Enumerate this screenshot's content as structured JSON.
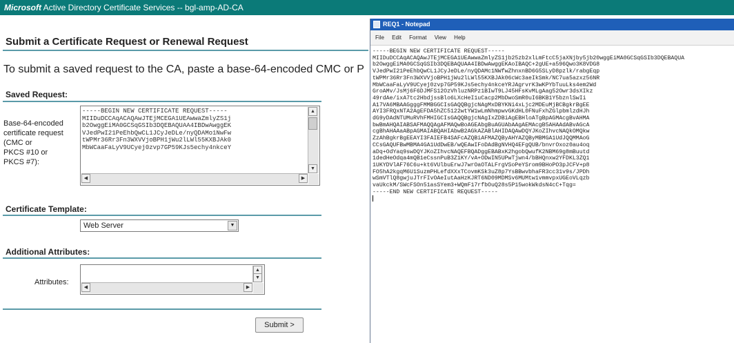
{
  "window": {
    "brand": "Microsoft",
    "title": "Active Directory Certificate Services  --  bgl-amp-AD-CA"
  },
  "page": {
    "heading": "Submit a Certificate Request or Renewal Request",
    "intro": "To submit a saved request to the CA, paste a base-64-encoded CMC or P"
  },
  "saved_request": {
    "section_title": "Saved Request:",
    "label": "Base-64-encoded\ncertificate request\n(CMC or\nPKCS #10 or\nPKCS #7):",
    "lines": [
      "-----BEGIN NEW CERTIFICATE REQUEST-----",
      "MIIDuDCCAqACAQAwJTEjMCEGA1UEAwwaZmlyZS1j",
      "b2OwggEiMA0GCSqGSIb3DQEBAQUAA4IBDwAwggEK",
      "VJedPwI21PeEhbQwCL1JCyJeDLe/nyQDAMo1NwFw",
      "tWPMr36Rr3Fn3WXVVjoBPH1jWu2lLWl55KXBJAk0",
      "MbWCaaFaLyV9UCyej0zvp7GP59KJs5echy4nkceY"
    ]
  },
  "template": {
    "section_title": "Certificate Template:",
    "selected": "Web Server"
  },
  "attributes": {
    "section_title": "Additional Attributes:",
    "label": "Attributes:",
    "value": ""
  },
  "submit_label": "Submit >",
  "notepad": {
    "title": "REQ1 - Notepad",
    "menu": [
      "File",
      "Edit",
      "Format",
      "View",
      "Help"
    ],
    "lines": [
      "-----BEGIN NEW CERTIFICATE REQUEST-----",
      "MIIDuDCCAqACAQAwJTEjMCEGA1UEAwwaZmlyZS1jb25zb2xlLmFtcC5jaXNjby5jb20wggEiMA0GCSqGSIb3DQEBAQUA",
      "b2OwggEiMA0GCSqGSIb3DQEBAQUAA4IBDwAwggEKAoIBAQC+2gUE+a596Qwo3K8VDG8",
      "VJedPwI21PeEhbQwCL1JCyJeDLe/nyQDAMc1NWfwZhnxnBD6G5SLyD8pzlk/rabgEqp",
      "tWPMr36Rr3Fn3WXVVjoBPH1jWu2lLWl55KXBJAk06cWc3aeIkSmk/NC7ua5azxz56NR",
      "MbWCaaFaLyV9UCyej0zvp7GP59KJs5echy4nkceYRJAgrvrK3wKPYbTuuLks4em2Wd",
      "GroAMv/JsMj6F6DJMFS12OzVhluzNRPz1BIwT9LJ45HFsKvMLgAag52Owr3dsXIkz",
      "49rdAe/ixA7tc2HbdjssBlo6LXcHeI1uCacp2MbDwoSmR0uI6BKB1Y5bznlSwIi",
      "A17VA6MBAAGgggFMMBGGCIsGAQQBgjcNAgMxDBYKNi4xLjc2MDEuMjBCBgkrBgEE",
      "AYI3FRQxNTA2AgEFDA5hZC5122wtYW1wLmNhmpwvGKdHL0FNuFxhZGlpbmlzdHJh",
      "dG9yDAdNTUMuRVhFMHIGCIsGAQQBgjcNAgIxZDBiAgEBHloATgBpAGMAcgBvAHMA",
      "bwBmAHQAIABSAFMAQQAgAFMAQwBoAGEAbgBuAGUAbAAgAEMAcgB5AHAAdABvAGcA",
      "cgBhAHAAaABpAGMAIABQAHIAbwB2AGkAZABlAHIDAQAwDQYJKoZIhvcNAQkOMQkw",
      "ZzAhBgkrBgEEAYI3FAIEFB4SAFcAZQBiAFMAZQByAHYAZQByMBMGA1UdJQQMMAoG",
      "CCsGAQUFBwMBMA4GA1UdDwEB/wQEAwIFoDAdBgNVHQ4EFgQUB/bnvrOxoz0au4oq",
      "aDq+OdYaq9swDQYJKoZIhvcNAQEFBQADggEBABxK2hgobQwufK2NBM69g8mBuutd",
      "1dedHeOdqa4mQB1eCssnPuB3Z1KY/vA+ODwIN5UPwTjwn4/bBHQnxw2YFDKL3ZQ1",
      "1UKYDVlAF76C6u+kt6VUlbuErwJ7wrOaOTALFrgVSoPeYSrom9BHoPO3pJCFV+p8",
      "FO5hA2kgqM6U1SuzmPHLefdXXxTCovmKSk3uZ8p7YsBBwvbhaFR3cc31v9s/JPDh",
      "wSmVTlQ8gwjuJTrFIvOAeIutAaHzKJRT6ND09MDMSv6MUMtw1vmmvpxUGEoVLqzb",
      "vaUkckM/SWcFSOn51asSYem3+WQmF17rfbOuQ28s5P15wokWkdsN4cC+Tqg=",
      "-----END NEW CERTIFICATE REQUEST-----"
    ]
  }
}
